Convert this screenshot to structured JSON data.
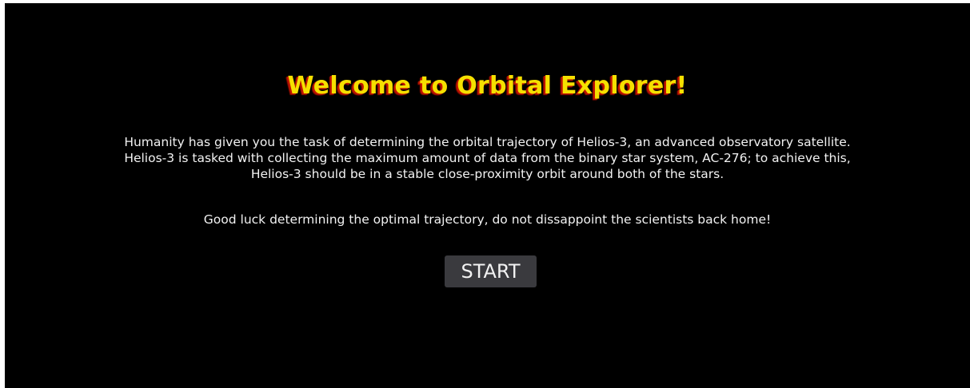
{
  "welcome": {
    "title": "Welcome to Orbital Explorer!",
    "intro_lines": [
      "Humanity has given you the task of determining the orbital trajectory of Helios-3, an advanced observatory satellite.",
      "Helios-3 is tasked with collecting the maximum amount of data from the binary star system, AC-276; to achieve this,",
      "Helios-3 should be in a stable close-proximity orbit around both of the stars."
    ],
    "closing_line": "Good luck determining the optimal trajectory, do not dissappoint the scientists back home!",
    "start_label": "START"
  },
  "colors": {
    "background": "#000000",
    "title": "#f5e000",
    "title_shadow": "#c21500",
    "text": "#f2f2f2",
    "button": "#3a3a3e"
  }
}
